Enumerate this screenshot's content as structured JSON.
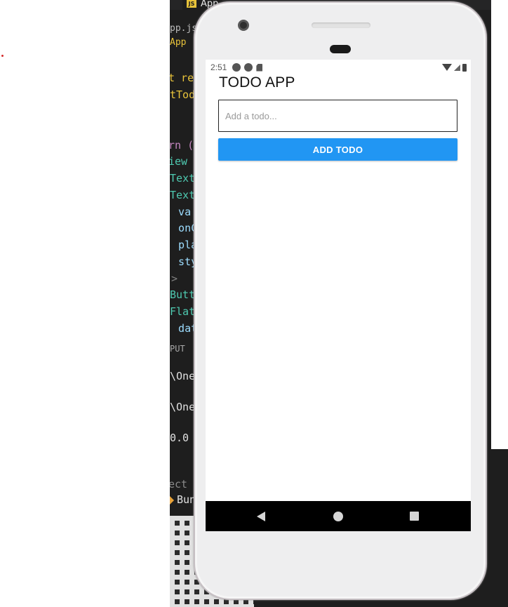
{
  "editor": {
    "tab_label": "App",
    "tab_icon": "js-file-icon",
    "breadcrumb_lines": [
      "pp.js",
      "App"
    ],
    "code_lines": [
      {
        "text": "t ren",
        "color": "#e8c33a"
      },
      {
        "text": "tTodo",
        "color": "#e8c33a"
      },
      {
        "text": "rn (",
        "color": "#c586c0"
      },
      {
        "text": "iew",
        "color": "#4ec9b0"
      },
      {
        "text": "Text",
        "color": "#4ec9b0"
      },
      {
        "text": "Text",
        "color": "#4ec9b0"
      },
      {
        "text": "  va",
        "color": "#9cdcfe"
      },
      {
        "text": "  onC",
        "color": "#9cdcfe"
      },
      {
        "text": "  pla",
        "color": "#9cdcfe"
      },
      {
        "text": "  sty",
        "color": "#9cdcfe"
      },
      {
        "text": ">",
        "color": "#808080"
      },
      {
        "text": "Butt",
        "color": "#4ec9b0"
      },
      {
        "text": "Flat",
        "color": "#4ec9b0"
      },
      {
        "text": "  dat",
        "color": "#9cdcfe"
      }
    ],
    "terminal": {
      "panel_label": "PUT",
      "lines": [
        "\\One",
        "\\One",
        "0.0",
        "ect a",
        "Bun"
      ]
    }
  },
  "status_bar": {
    "time": "2:51"
  },
  "app": {
    "title": "TODO APP",
    "input_placeholder": "Add a todo...",
    "input_value": "",
    "add_button_label": "ADD TODO",
    "accent_color": "#2196f3"
  }
}
